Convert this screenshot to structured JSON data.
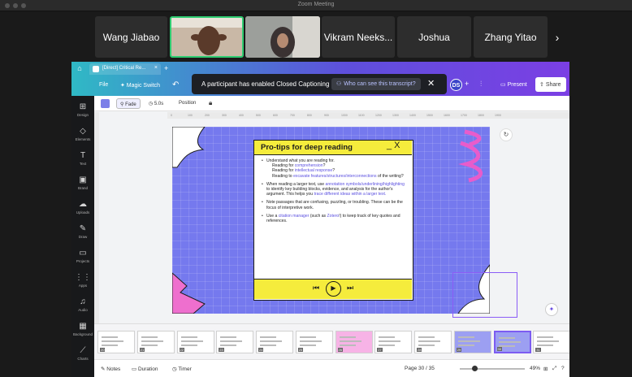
{
  "window": {
    "title": "Zoom Meeting"
  },
  "participants": [
    {
      "name": "Wang Jiabao",
      "video": false
    },
    {
      "name": "",
      "video": true
    },
    {
      "name": "",
      "video": true
    },
    {
      "name": "Vikram Neeks...",
      "video": false
    },
    {
      "name": "Joshua",
      "video": false
    },
    {
      "name": "Zhang Yitao",
      "video": false
    }
  ],
  "strip_next_icon": "chevron-right-icon",
  "canva": {
    "tab_title": "[Direct] Critical Re...",
    "menu": {
      "file": "File",
      "magic_switch": "✦ Magic Switch"
    },
    "cc_banner": {
      "message": "A participant has enabled Closed Captioning",
      "who_button": "Who can see this transcript?"
    },
    "avatar_initials": "DS",
    "present_label": "Present",
    "share_label": "Share",
    "rail": [
      {
        "icon": "⊞",
        "label": "Design"
      },
      {
        "icon": "◇",
        "label": "Elements"
      },
      {
        "icon": "T",
        "label": "Text"
      },
      {
        "icon": "▣",
        "label": "Brand"
      },
      {
        "icon": "☁",
        "label": "Uploads"
      },
      {
        "icon": "✎",
        "label": "Draw"
      },
      {
        "icon": "▭",
        "label": "Projects"
      },
      {
        "icon": "⋮⋮",
        "label": "Apps"
      },
      {
        "icon": "♫",
        "label": "Audio"
      },
      {
        "icon": "▦",
        "label": "Background"
      },
      {
        "icon": "⟋",
        "label": "Charts"
      }
    ],
    "toolbar": {
      "fade": "Fade",
      "duration": "5.0s",
      "position": "Position"
    },
    "ruler_ticks": [
      "0",
      "100",
      "200",
      "300",
      "400",
      "500",
      "600",
      "700",
      "800",
      "900",
      "1000",
      "1100",
      "1200",
      "1300",
      "1400",
      "1500",
      "1600",
      "1700",
      "1800",
      "1900"
    ],
    "slide": {
      "title": "Pro-tips for deep reading",
      "title_controls": "_ X",
      "bullets": {
        "b1_intro": "Understand what you are reading for.",
        "b1_l1_pre": "Reading for ",
        "b1_l1_hl": "comprehension",
        "b1_l1_post": "?",
        "b1_l2_pre": "Reading for ",
        "b1_l2_hl": "intellectual response",
        "b1_l2_post": "?",
        "b1_l3_pre": "Reading to ",
        "b1_l3_hl": "excavate features/structures/interconnections",
        "b1_l3_post": " of the writing?",
        "b2_pre": "When reading a larger text, use ",
        "b2_hl1": "annotation symbols/underlining/highlighting",
        "b2_mid": " to identify key building blocks, evidence, and analysis for the author's argument. This helps you ",
        "b2_hl2": "trace different ideas within a larger text.",
        "b3": "Note passages that are confusing, puzzling, or troubling. These can be the focus of interpretive work.",
        "b4_pre": "Use a ",
        "b4_hl1": "citation manager",
        "b4_mid": " (such as ",
        "b4_hl2": "Zotero",
        "b4_post": "!) to keep track of key quotes and references."
      }
    },
    "thumbnails": [
      "20",
      "21",
      "22",
      "23",
      "24",
      "25",
      "26",
      "27",
      "28",
      "29",
      "30",
      "31"
    ],
    "active_thumbnail": "30",
    "bottom": {
      "notes": "Notes",
      "duration": "Duration",
      "timer": "Timer",
      "page": "Page 30 / 35",
      "zoom": "49%"
    }
  },
  "colors": {
    "slide_bg": "#7579ee",
    "accent_yellow": "#f5ec3c",
    "brand_purple": "#7c5cf1",
    "active_speaker": "#2ecc71"
  }
}
